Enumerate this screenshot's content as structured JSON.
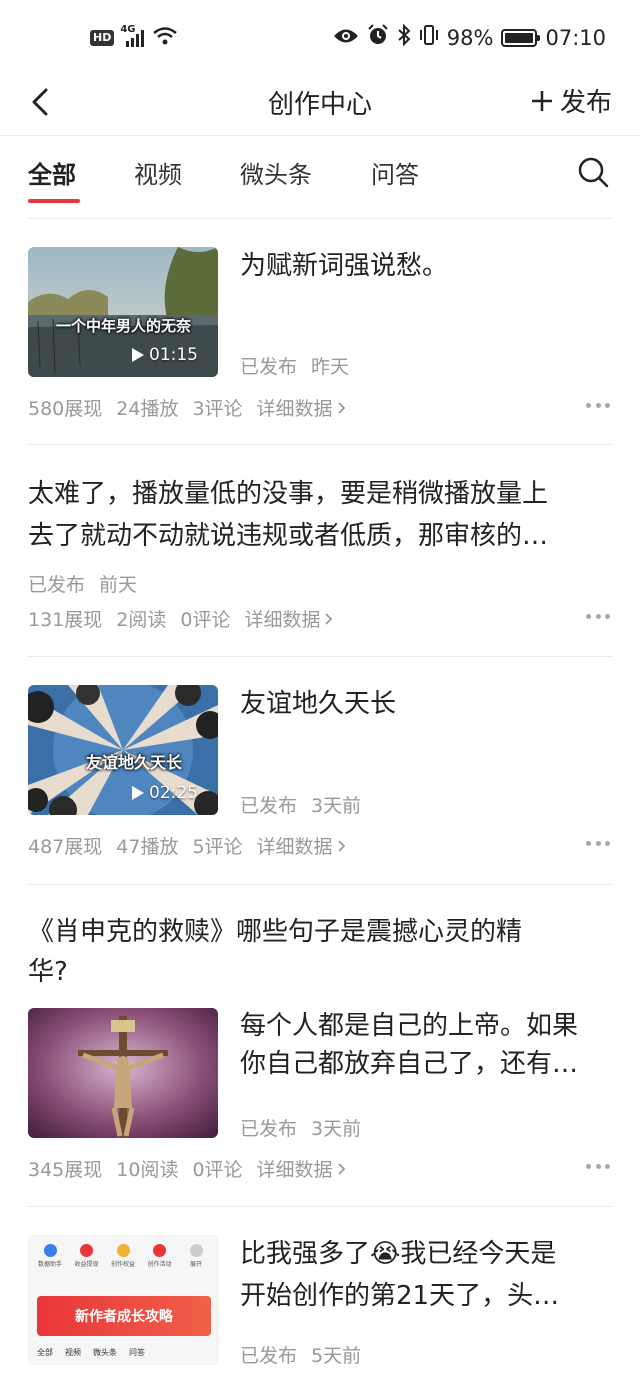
{
  "status_bar": {
    "hd": "HD",
    "network": "4G",
    "battery_percent": "98%",
    "battery_level": 0.98,
    "time": "07:10"
  },
  "header": {
    "title": "创作中心",
    "publish_label": "发布"
  },
  "tabs": [
    {
      "label": "全部",
      "active": true
    },
    {
      "label": "视频",
      "active": false
    },
    {
      "label": "微头条",
      "active": false
    },
    {
      "label": "问答",
      "active": false
    }
  ],
  "items": [
    {
      "title": "为赋新词强说愁。",
      "thumb_overlay": "一个中年男人的无奈",
      "duration": "01:15",
      "status": "已发布",
      "time": "昨天",
      "stats": [
        "580展现",
        "24播放",
        "3评论"
      ],
      "detail_label": "详细数据"
    },
    {
      "title_line1": "太难了，播放量低的没事，要是稍微播放量上",
      "title_line2": "去了就动不动就说违规或者低质，那审核的…",
      "status": "已发布",
      "time": "前天",
      "stats": [
        "131展现",
        "2阅读",
        "0评论"
      ],
      "detail_label": "详细数据"
    },
    {
      "title": "友谊地久天长",
      "thumb_overlay": "友谊地久天长",
      "duration": "02:25",
      "status": "已发布",
      "time": "3天前",
      "stats": [
        "487展现",
        "47播放",
        "5评论"
      ],
      "detail_label": "详细数据"
    },
    {
      "question_line1": "《肖申克的救赎》哪些句子是震撼心灵的精",
      "question_line2": "华?",
      "title_line1": "每个人都是自己的上帝。如果",
      "title_line2": "你自己都放弃自己了，还有…",
      "status": "已发布",
      "time": "3天前",
      "stats": [
        "345展现",
        "10阅读",
        "0评论"
      ],
      "detail_label": "详细数据"
    },
    {
      "title_line1": "比我强多了😭我已经今天是",
      "title_line2": "开始创作的第21天了，头…",
      "status": "已发布",
      "time": "5天前",
      "thumb_banner": "新作者成长攻略",
      "thumb_icons": [
        "数据助手",
        "收益提现",
        "创作权益",
        "创作活动",
        "展开"
      ],
      "thumb_tabs": [
        "全部",
        "视频",
        "微头条",
        "问答"
      ]
    }
  ],
  "colors": {
    "accent": "#e8363a",
    "text_primary": "#222222",
    "text_secondary": "#999999",
    "divider": "#ececec"
  }
}
